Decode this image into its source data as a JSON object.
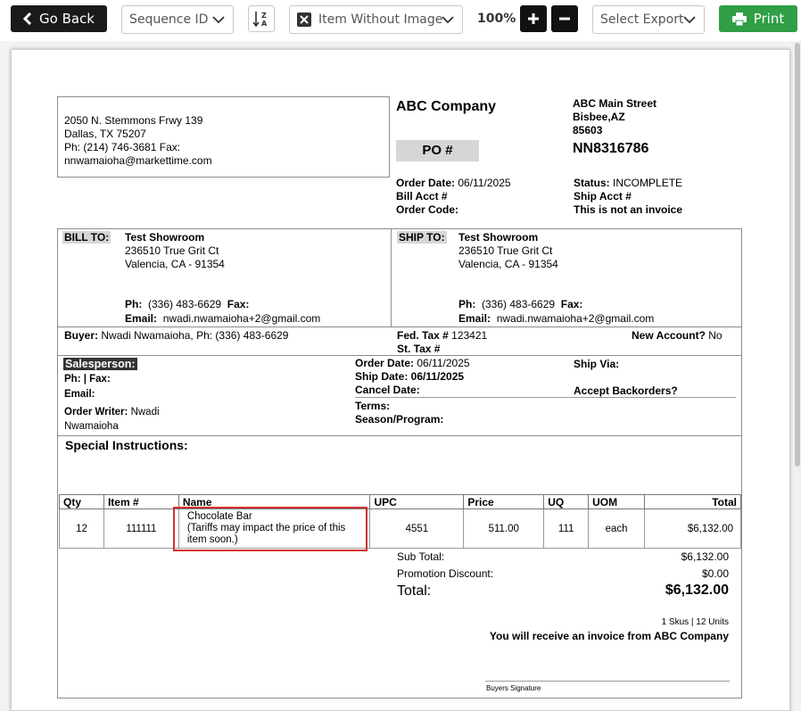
{
  "toolbar": {
    "go_back": "Go Back",
    "sort_field": "Sequence ID",
    "image_filter": "Item Without Image",
    "zoom": "100%",
    "export_placeholder": "Select Export",
    "print": "Print"
  },
  "vendor": {
    "street": "2050 N. Stemmons Frwy 139",
    "city": "Dallas, TX 75207",
    "phone": "Ph: (214) 746-3681  Fax:",
    "email": "nnwamaioha@markettime.com"
  },
  "company": {
    "name": "ABC Company",
    "street": "ABC Main Street",
    "city": "Bisbee,AZ",
    "zip": "85603"
  },
  "po": {
    "label": "PO #",
    "number": "NN8316786",
    "order_date_label": "Order Date:",
    "order_date": "06/11/2025",
    "bill_acct_label": "Bill Acct #",
    "order_code_label": "Order Code:",
    "status_label": "Status:",
    "status": "INCOMPLETE",
    "ship_acct_label": "Ship Acct #",
    "not_invoice": "This is not an invoice"
  },
  "bill_to": {
    "label": "BILL TO:",
    "name": "Test Showroom",
    "street": "236510 True Grit Ct",
    "city": "Valencia, CA - 91354",
    "ph_label": "Ph:",
    "phone": "(336) 483-6629",
    "fax_label": "Fax:",
    "email_label": "Email:",
    "email": "nwadi.nwamaioha+2@gmail.com"
  },
  "ship_to": {
    "label": "SHIP TO:",
    "name": "Test Showroom",
    "street": "236510 True Grit Ct",
    "city": "Valencia, CA - 91354",
    "ph_label": "Ph:",
    "phone": "(336) 483-6629",
    "fax_label": "Fax:",
    "email_label": "Email:",
    "email": "nwadi.nwamaioha+2@gmail.com"
  },
  "buyer": {
    "label": "Buyer:",
    "value": "Nwadi Nwamaioha, Ph: (336) 483-6629",
    "fed_tax_label": "Fed. Tax #",
    "fed_tax": "123421",
    "st_tax_label": "St. Tax #",
    "new_account_label": "New Account?",
    "new_account": "No"
  },
  "sales": {
    "salesperson_label": "Salesperson:",
    "ph_fax": "Ph: | Fax:",
    "email_label": "Email:",
    "writer_label": "Order Writer:",
    "writer_first": "Nwadi",
    "writer_last": "Nwamaioha",
    "order_date_label": "Order Date:",
    "order_date": "06/11/2025",
    "ship_date": "Ship Date: 06/11/2025",
    "cancel_label": "Cancel Date:",
    "terms_label": "Terms:",
    "season_label": "Season/Program:",
    "ship_via_label": "Ship Via:",
    "backorders_label": "Accept Backorders?"
  },
  "special_instructions": "Special Instructions:",
  "table": {
    "headers": [
      "Qty",
      "Item #",
      "Name",
      "UPC",
      "Price",
      "UQ",
      "UOM",
      "Total"
    ],
    "rows": [
      {
        "qty": "12",
        "item": "111111",
        "name": "Chocolate Bar",
        "note": "(Tariffs may impact the price of this item soon.)",
        "upc": "4551",
        "price": "511.00",
        "uq": "111",
        "uom": "each",
        "total": "$6,132.00"
      }
    ]
  },
  "totals": {
    "subtotal_label": "Sub Total:",
    "subtotal": "$6,132.00",
    "promo_label": "Promotion Discount:",
    "promo": "$0.00",
    "total_label": "Total:",
    "total": "$6,132.00",
    "skus": "1 Skus | 12 Units",
    "invoice_note": "You will receive an invoice from ABC Company",
    "signature_label": "Buyers Signature"
  },
  "colors": {
    "print_green": "#2f9e44",
    "highlight_red": "#d32f2f"
  }
}
